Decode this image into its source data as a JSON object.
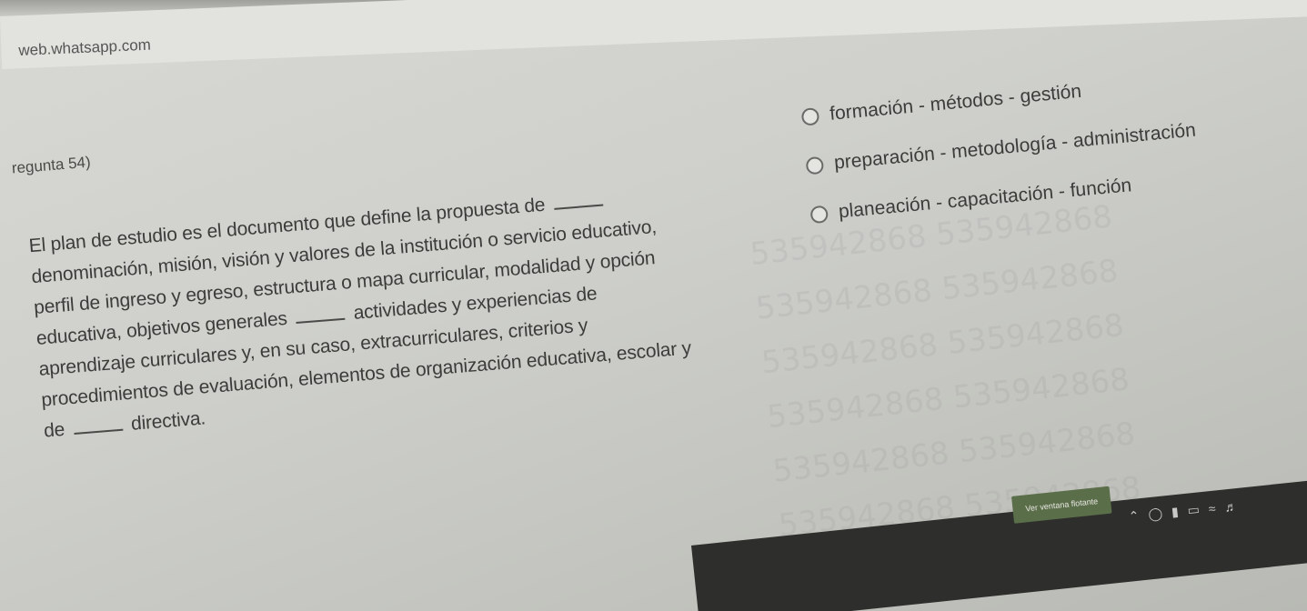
{
  "browser": {
    "url": "web.whatsapp.com"
  },
  "question": {
    "label": "regunta 54)",
    "lines": [
      "El plan de estudio es el documento que define la propuesta de",
      "denominación, misión, visión y valores de la institución o servicio educativo,",
      "perfil de ingreso y egreso, estructura o mapa curricular, modalidad y opción",
      "educativa, objetivos generales",
      "actividades y experiencias de",
      "aprendizaje curriculares y, en su caso, extracurriculares, criterios y",
      "procedimientos de evaluación, elementos de organización educativa, escolar y",
      "de",
      "directiva."
    ]
  },
  "options": [
    {
      "label": "formación - métodos - gestión"
    },
    {
      "label": "preparación - metodología - administración"
    },
    {
      "label": "planeación - capacitación - función"
    }
  ],
  "watermark": {
    "text": "535942868 535942868 535942868 535942868 535942868 535942868 535942868 535942868 535942868 535942868 535942868 535942868"
  },
  "taskbar": {
    "button_label": "Ver ventana flotante",
    "tray_icons": [
      "chevron-up-icon",
      "notification-icon",
      "battery-icon",
      "monitor-icon",
      "wifi-icon",
      "volume-icon"
    ]
  }
}
